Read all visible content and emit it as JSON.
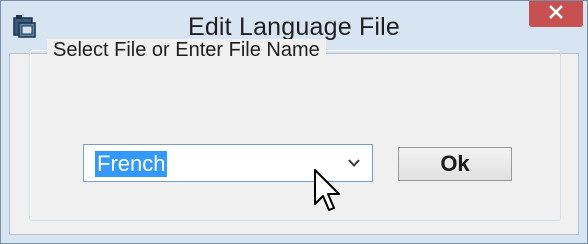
{
  "window": {
    "title": "Edit Language File",
    "app_icon": "app-window-icon",
    "close_icon": "close-icon"
  },
  "group": {
    "label": "Select File or Enter File Name"
  },
  "file_combo": {
    "value": "French",
    "arrow_icon": "chevron-down-icon"
  },
  "buttons": {
    "ok_label": "Ok"
  },
  "colors": {
    "titlebar": "#d7e4f2",
    "close_button": "#c75050",
    "selection": "#3399ff",
    "client": "#f0f0f0"
  },
  "pointer": "mouse-cursor-icon"
}
